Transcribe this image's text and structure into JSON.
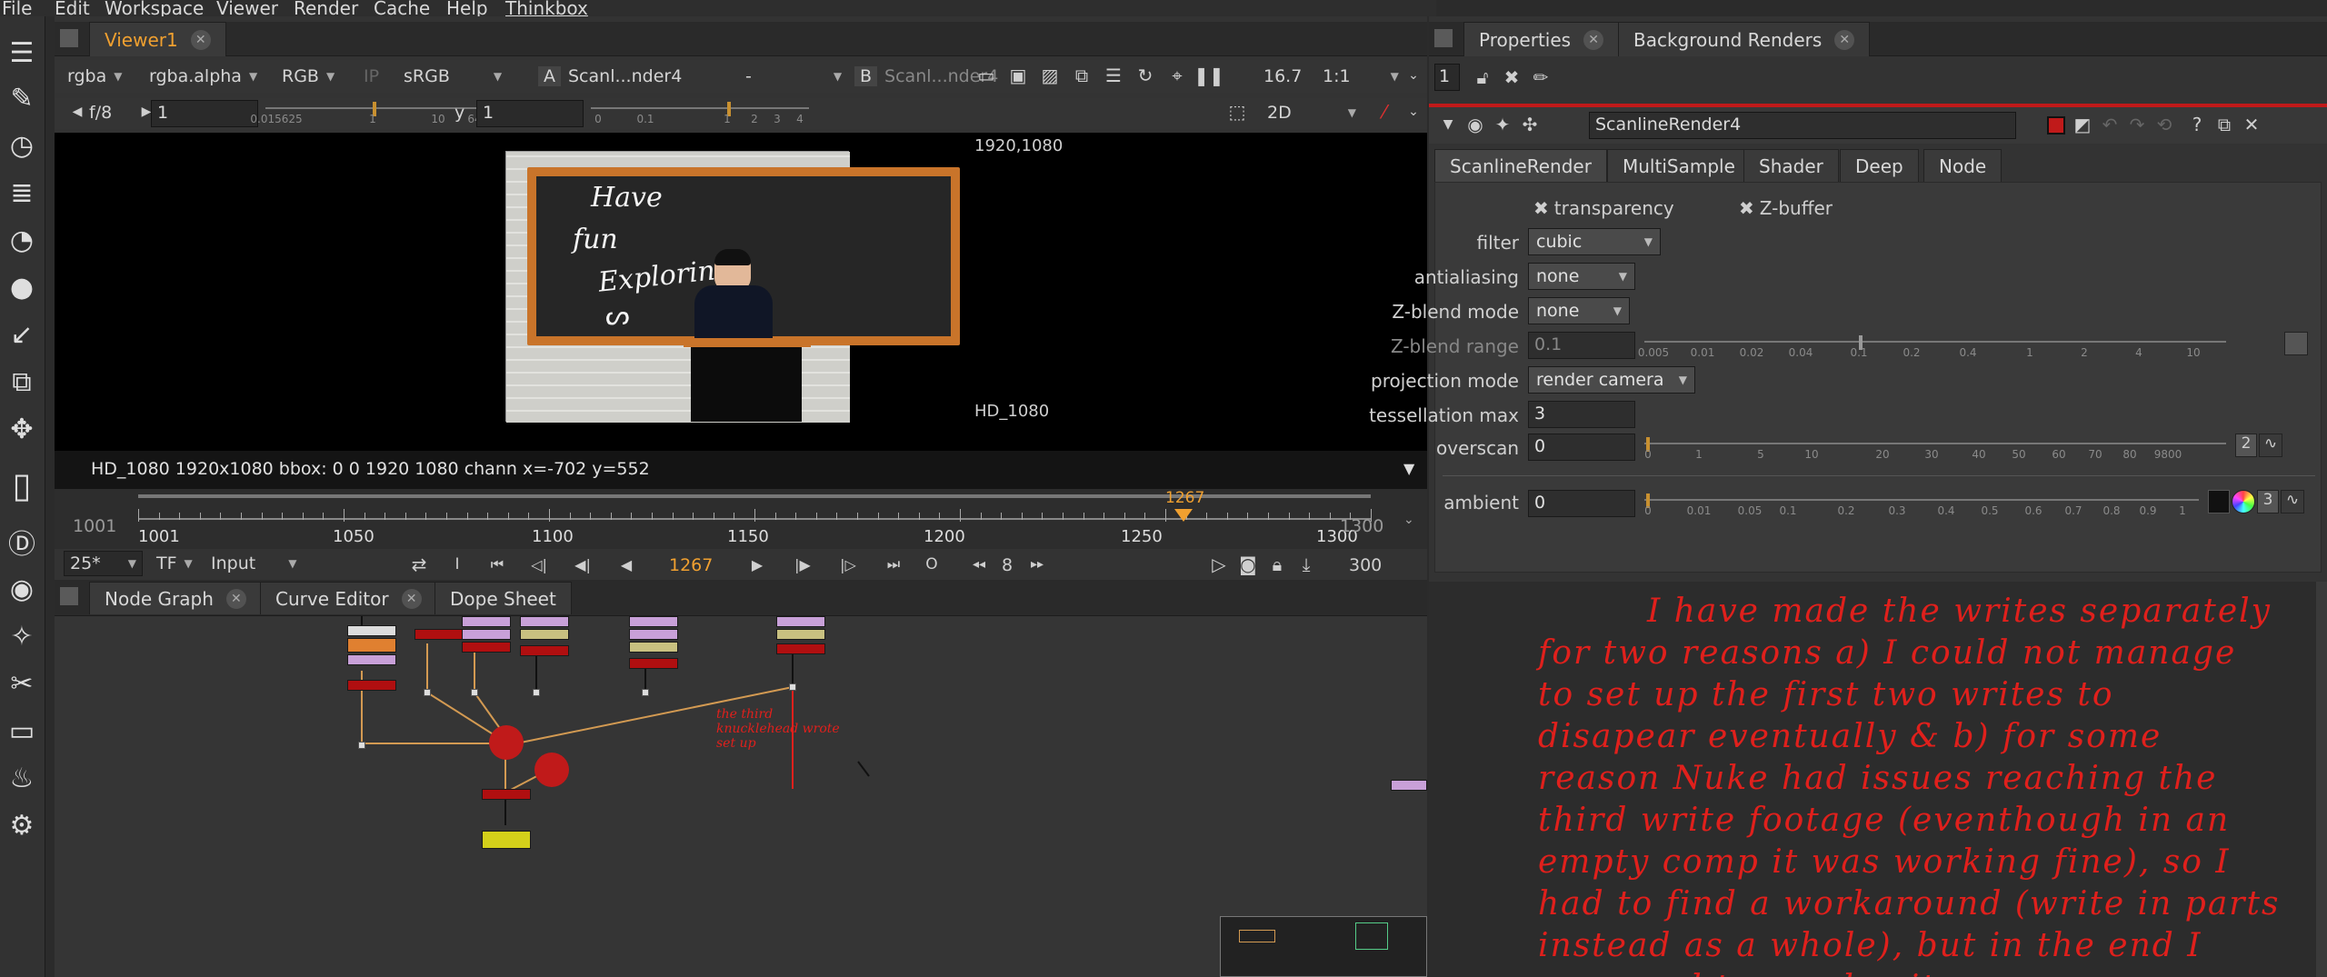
{
  "menu": [
    "File",
    "Edit",
    "Workspace",
    "Viewer",
    "Render",
    "Cache",
    "Help",
    "Thinkbox"
  ],
  "viewer": {
    "tab": "Viewer1",
    "controls": {
      "channels": "rgba",
      "alpha": "rgba.alpha",
      "display": "RGB",
      "ip": "IP",
      "lut": "sRGB",
      "a_label": "A",
      "a_input": "Scanl...nder4",
      "a_op": "-",
      "b_label": "B",
      "b_input": "Scanl...nder4",
      "zoom": "16.7",
      "ratio": "1:1",
      "fstop": "f/8",
      "gain": "1",
      "gamma_label": "y",
      "gamma": "1",
      "view_mode": "2D"
    },
    "gain_ticks": [
      "0.015625",
      "1",
      "10",
      "64"
    ],
    "gamma_ticks": [
      "0",
      "0.1",
      "1",
      "2",
      "3",
      "4"
    ],
    "format_top": "1920,1080",
    "format_bottom": "HD_1080",
    "status": "HD_1080 1920x1080  bbox: 0 0 1920 1080 chann  x=-702 y=552",
    "image_text": [
      "Have",
      "fun",
      "Exploring"
    ]
  },
  "timeline": {
    "start": "1001",
    "end": "1300",
    "current": "1267",
    "ticks": [
      "1001",
      "1050",
      "1100",
      "1150",
      "1200",
      "1250",
      "1300"
    ],
    "fps": "25*",
    "tf": "TF",
    "mode": "Input",
    "frame": "1267",
    "step": "8",
    "end_frame": "300",
    "i_label": "I",
    "o_label": "O"
  },
  "nodegraph": {
    "tabs": [
      "Node Graph",
      "Curve Editor",
      "Dope Sheet"
    ],
    "note": "the third knucklehead wrote set up"
  },
  "properties": {
    "tabs": [
      "Properties",
      "Background Renders"
    ],
    "count": "1",
    "node_name": "ScanlineRender4",
    "subtabs": [
      "ScanlineRender",
      "MultiSample",
      "Shader",
      "Deep",
      "Node"
    ],
    "transparency": "transparency",
    "zbuffer": "Z-buffer",
    "filter_label": "filter",
    "filter": "cubic",
    "aa_label": "antialiasing",
    "aa": "none",
    "zblend_label": "Z-blend mode",
    "zblend": "none",
    "zrange_label": "Z-blend range",
    "zrange": "0.1",
    "zrange_ticks": [
      "0.005",
      "0.01",
      "0.02",
      "0.04",
      "0.1",
      "0.2",
      "0.4",
      "1",
      "2",
      "4",
      "10"
    ],
    "proj_label": "projection mode",
    "proj": "render camera",
    "tess_label": "tessellation max",
    "tess": "3",
    "overscan_label": "overscan",
    "overscan": "0",
    "overscan_ticks": [
      "0",
      "1",
      "5",
      "10",
      "20",
      "30",
      "40",
      "50",
      "60",
      "70",
      "80",
      "9800"
    ],
    "overscan_btn": "2",
    "ambient_label": "ambient",
    "ambient": "0",
    "ambient_ticks": [
      "0",
      "0.01",
      "0.05",
      "0.1",
      "0.2",
      "0.3",
      "0.4",
      "0.5",
      "0.6",
      "0.7",
      "0.8",
      "0.9",
      "1"
    ],
    "ambient_btn": "3"
  },
  "handwritten_note": "I have made the writes separately for two reasons a) I could not manage to set up the first two writes to disapear eventually & b) for some reason Nuke had issues reaching the third write footage (eventhough in an empty comp it was working fine), so I had to find a workaround (write in parts instead as a whole), but in the end I managed to resolve it",
  "colors": {
    "accent_orange": "#f0a030",
    "node_red": "#b00f10",
    "dot_red": "#c01a1a",
    "ink_red": "#e0201c"
  }
}
